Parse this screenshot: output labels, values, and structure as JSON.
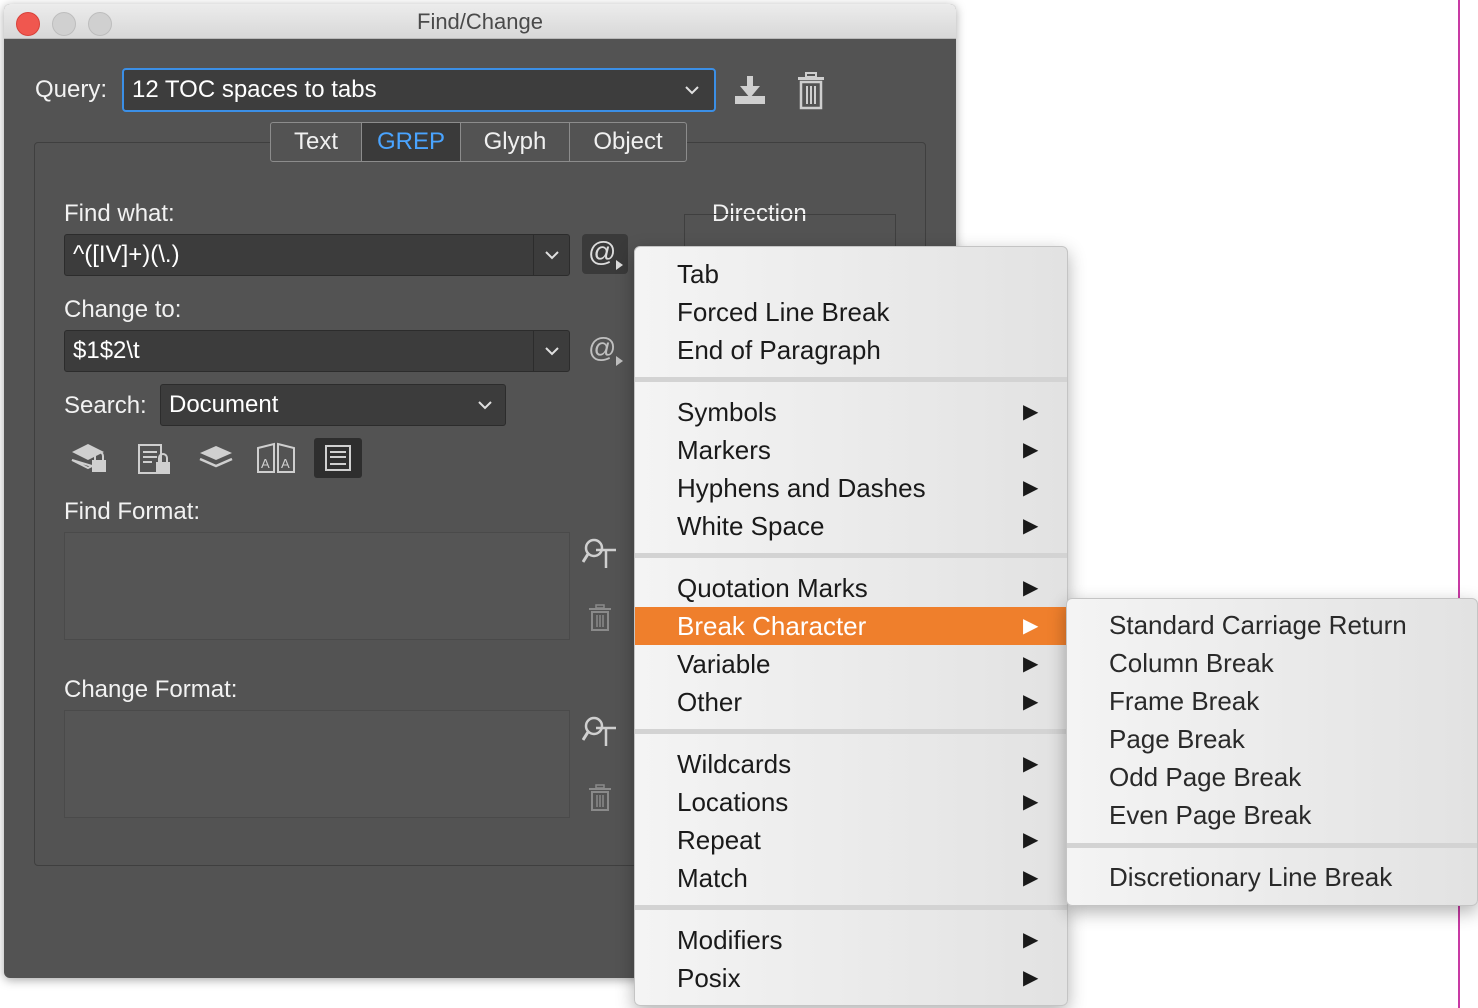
{
  "window": {
    "title": "Find/Change"
  },
  "query": {
    "label": "Query:",
    "value": "12 TOC spaces to tabs"
  },
  "tabs": [
    {
      "label": "Text"
    },
    {
      "label": "GREP"
    },
    {
      "label": "Glyph"
    },
    {
      "label": "Object"
    }
  ],
  "find": {
    "label": "Find what:",
    "value": "^([IV]+)(\\.)"
  },
  "change": {
    "label": "Change to:",
    "value": "$1$2\\t"
  },
  "search": {
    "label": "Search:",
    "value": "Document"
  },
  "direction": {
    "label": "Direction"
  },
  "find_format": {
    "label": "Find Format:"
  },
  "change_format": {
    "label": "Change Format:"
  },
  "special_char_icon": "@",
  "menu": {
    "groups": [
      [
        {
          "label": "Tab",
          "submenu": false
        },
        {
          "label": "Forced Line Break",
          "submenu": false
        },
        {
          "label": "End of Paragraph",
          "submenu": false
        }
      ],
      [
        {
          "label": "Symbols",
          "submenu": true
        },
        {
          "label": "Markers",
          "submenu": true
        },
        {
          "label": "Hyphens and Dashes",
          "submenu": true
        },
        {
          "label": "White Space",
          "submenu": true
        }
      ],
      [
        {
          "label": "Quotation Marks",
          "submenu": true
        },
        {
          "label": "Break Character",
          "submenu": true,
          "highlighted": true
        },
        {
          "label": "Variable",
          "submenu": true
        },
        {
          "label": "Other",
          "submenu": true
        }
      ],
      [
        {
          "label": "Wildcards",
          "submenu": true
        },
        {
          "label": "Locations",
          "submenu": true
        },
        {
          "label": "Repeat",
          "submenu": true
        },
        {
          "label": "Match",
          "submenu": true
        }
      ],
      [
        {
          "label": "Modifiers",
          "submenu": true
        },
        {
          "label": "Posix",
          "submenu": true
        }
      ]
    ],
    "highlight_color": "#ef7f2c"
  },
  "submenu": {
    "groups": [
      [
        "Standard Carriage Return",
        "Column Break",
        "Frame Break",
        "Page Break",
        "Odd Page Break",
        "Even Page Break"
      ],
      [
        "Discretionary Line Break"
      ]
    ]
  }
}
